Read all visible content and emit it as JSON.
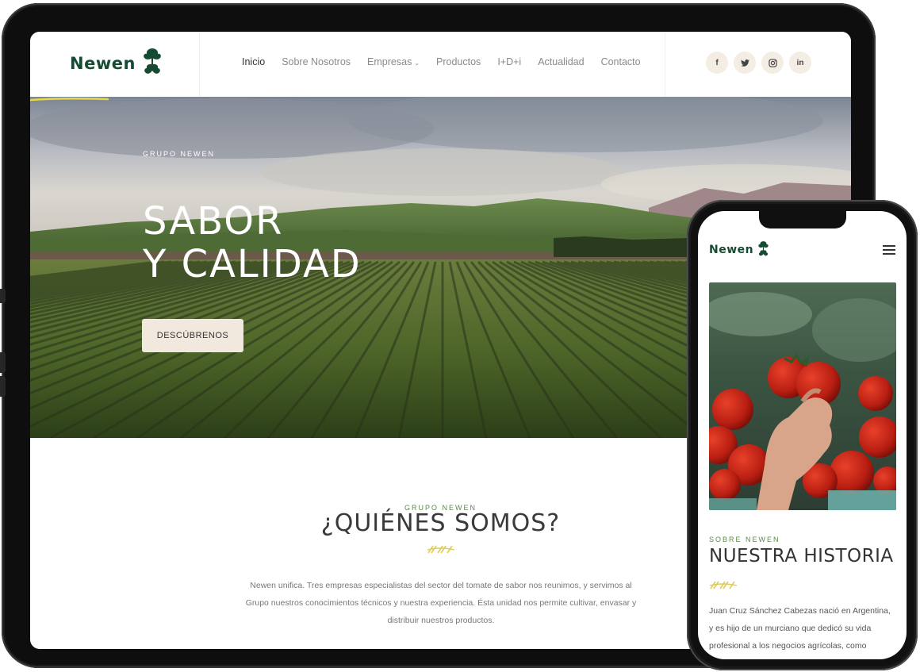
{
  "brand": {
    "name": "Newen",
    "green": "#174a33",
    "accent_yellow": "#e8d74a",
    "beige": "#f1e8de"
  },
  "nav": {
    "items": [
      "Inicio",
      "Sobre Nosotros",
      "Empresas",
      "Productos",
      "I+D+i",
      "Actualidad",
      "Contacto"
    ],
    "active": "Inicio"
  },
  "social": [
    {
      "icon": "facebook-icon",
      "glyph": "f"
    },
    {
      "icon": "twitter-icon",
      "glyph": "t"
    },
    {
      "icon": "instagram-icon",
      "glyph": "◎"
    },
    {
      "icon": "linkedin-icon",
      "glyph": "in"
    }
  ],
  "hero": {
    "eyebrow": "GRUPO NEWEN",
    "title_line1": "SABOR",
    "title_line2": "Y CALIDAD",
    "button": "DESCÚBRENOS"
  },
  "about": {
    "eyebrow": "GRUPO NEWEN",
    "title": "¿QUIÉNES SOMOS?",
    "text": "Newen unifica. Tres empresas especialistas del sector del tomate de sabor nos reunimos, y servimos al Grupo nuestros conocimientos técnicos y nuestra experiencia. Ésta unidad nos permite cultivar, envasar y distribuir nuestros productos."
  },
  "phone": {
    "eyebrow": "SOBRE NEWEN",
    "title": "NUESTRA HISTORIA",
    "text": "Juan Cruz Sánchez Cabezas nació en Argentina, y es hijo de un murciano que dedicó su vida profesional a los negocios agrícolas, como"
  }
}
